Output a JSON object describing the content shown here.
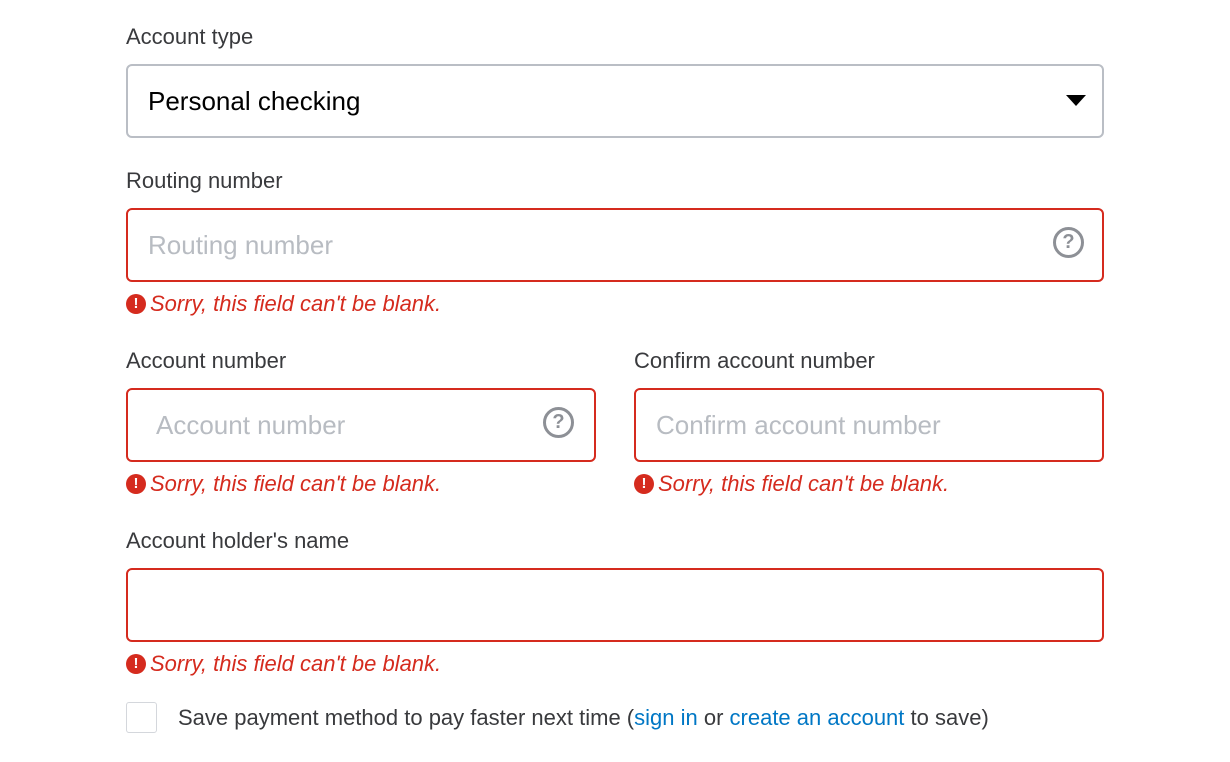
{
  "account_type": {
    "label": "Account type",
    "selected": "Personal checking"
  },
  "routing_number": {
    "label": "Routing number",
    "placeholder": "Routing number",
    "help": "?",
    "error": "Sorry, this field can't be blank."
  },
  "account_number": {
    "label": "Account number",
    "placeholder": "Account number",
    "help": "?",
    "error": "Sorry, this field can't be blank."
  },
  "confirm_account_number": {
    "label": "Confirm account number",
    "placeholder": "Confirm account number",
    "error": "Sorry, this field can't be blank."
  },
  "account_holder_name": {
    "label": "Account holder's name",
    "placeholder": "",
    "error": "Sorry, this field can't be blank."
  },
  "save_payment": {
    "checked": false,
    "text_before": "Save payment method to pay faster next time (",
    "sign_in_link": "sign in",
    "text_middle": " or ",
    "create_account_link": "create an account",
    "text_after": " to save)"
  },
  "error_icon_glyph": "!",
  "colors": {
    "error": "#d52b1e",
    "link": "#0077c5",
    "text": "#393a3d",
    "neutral_border": "#babec5"
  },
  "icons": {
    "dropdown": "caret-down-icon",
    "help": "question-circle-icon",
    "error": "exclamation-circle-icon"
  }
}
